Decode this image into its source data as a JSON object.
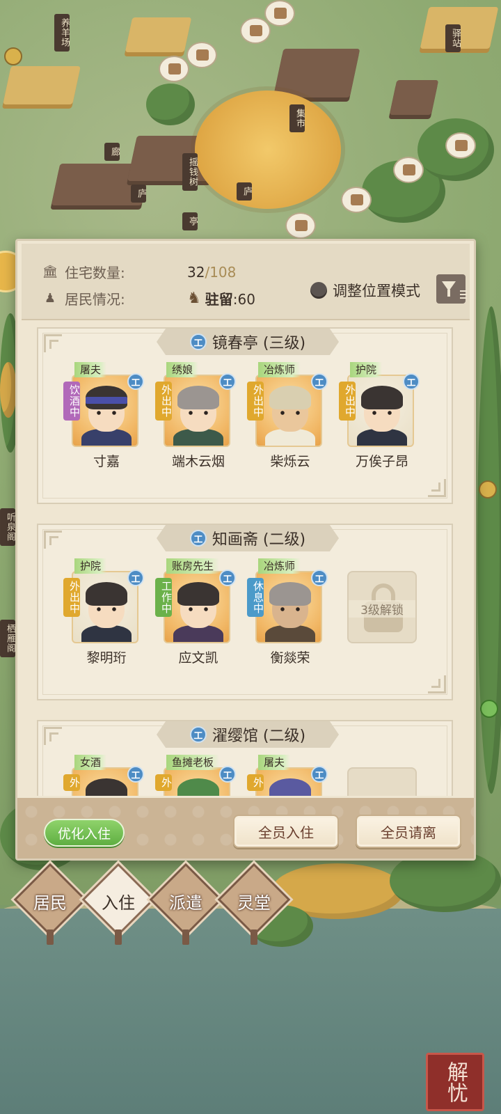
{
  "map": {
    "signs": [
      "养羊场",
      "集市",
      "驿站",
      "摇钱树",
      "廊",
      "庐",
      "庐",
      "亭",
      "听泉阁",
      "栖雁阁"
    ]
  },
  "header": {
    "housing_label": "住宅数量:",
    "housing_current": "32",
    "housing_max": "/108",
    "residents_label": "居民情况:",
    "stay_label": "驻留",
    "stay_value": ":60",
    "mode_label": "调整位置模式",
    "icons": {
      "housing": "building-icon",
      "residents": "person-icon",
      "horse": "horse-icon",
      "filter": "filter-icon"
    }
  },
  "badge_letter": "工",
  "houses": [
    {
      "name": "镜春亭 (三级)",
      "residents": [
        {
          "role": "屠夫",
          "status": "饮酒中",
          "status_type": "drink",
          "name": "寸嘉"
        },
        {
          "role": "绣娘",
          "status": "外出中",
          "status_type": "out",
          "name": "端木云烟"
        },
        {
          "role": "冶炼师",
          "status": "外出中",
          "status_type": "out",
          "name": "柴烁云"
        },
        {
          "role": "护院",
          "status": "外出中",
          "status_type": "out",
          "name": "万俟子昂"
        }
      ]
    },
    {
      "name": "知画斋 (二级)",
      "residents": [
        {
          "role": "护院",
          "status": "外出中",
          "status_type": "out",
          "name": "黎明珩"
        },
        {
          "role": "账房先生",
          "status": "工作中",
          "status_type": "work",
          "name": "应文凯"
        },
        {
          "role": "冶炼师",
          "status": "休息中",
          "status_type": "rest",
          "name": "衡燚荣"
        }
      ],
      "locked_label": "3级解锁"
    },
    {
      "name": "濯缨馆 (二级)",
      "residents": [
        {
          "role": "女酒",
          "status": "外",
          "status_type": "out",
          "name": ""
        },
        {
          "role": "鱼摊老板",
          "status": "外",
          "status_type": "out",
          "name": ""
        },
        {
          "role": "屠夫",
          "status": "外",
          "status_type": "out",
          "name": ""
        }
      ]
    }
  ],
  "footer": {
    "optimize": "优化入住",
    "all_checkin": "全员入住",
    "all_leave": "全员请离"
  },
  "tabs": [
    {
      "label": "居民",
      "active": false
    },
    {
      "label": "入住",
      "active": true
    },
    {
      "label": "派遣",
      "active": false
    },
    {
      "label": "灵堂",
      "active": false
    }
  ],
  "corner_seal": "解忧",
  "colors": {
    "accent_green": "#6bb14a",
    "out": "#e0a82e",
    "drink": "#b169b9",
    "rest": "#4b9ac9",
    "badge_blue": "#4d8cc4"
  }
}
